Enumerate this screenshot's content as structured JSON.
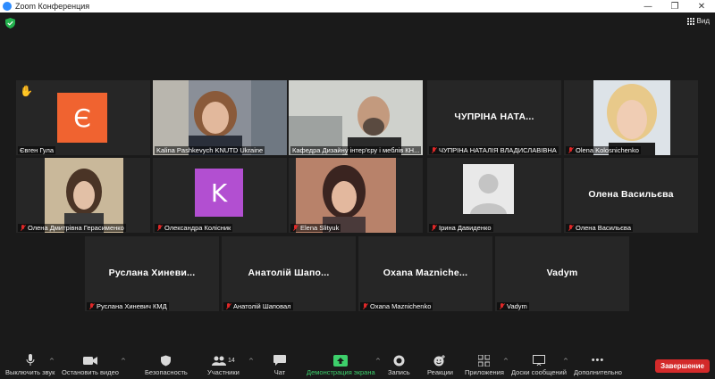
{
  "window": {
    "title": "Zoom Конференция",
    "minimize": "—",
    "maximize": "❐",
    "close": "✕"
  },
  "topbar": {
    "view_label": "Вид"
  },
  "participants": [
    {
      "id": "t1",
      "name": "Євген Гула",
      "avatar_letter": "Є",
      "avatar_color": "#f06330",
      "hand_raised": true,
      "muted": false
    },
    {
      "id": "t2",
      "name": "Kalina Pashkevych KNUTD Ukraine",
      "video": true,
      "muted": false
    },
    {
      "id": "t3",
      "name": "Кафедра Дизайну інтер'єру і меблів КН...",
      "video": true,
      "active_speaker": true,
      "muted": false
    },
    {
      "id": "t4",
      "name": "ЧУПРІНА НАТАЛІЯ ВЛАДИСЛАВІВНА",
      "display_name": "ЧУПРІНА НАТА...",
      "muted": true
    },
    {
      "id": "t5",
      "name": "Olena Kolosnichenko",
      "video": true,
      "muted": true
    },
    {
      "id": "t6",
      "name": "Олена Дмитрівна Герасименко",
      "video": true,
      "muted": true
    },
    {
      "id": "t7",
      "name": "Олександра Колісник",
      "avatar_letter": "K",
      "avatar_color": "#b24fd1",
      "muted": true
    },
    {
      "id": "t8",
      "name": "Elena Slityuk",
      "video": true,
      "muted": true
    },
    {
      "id": "t9",
      "name": "Ірина Давиденко",
      "placeholder_avatar": true,
      "muted": true
    },
    {
      "id": "t10",
      "name": "Олена Васильєва",
      "display_name": "Олена Васильєва",
      "muted": true
    },
    {
      "id": "t11",
      "name": "Руслана Хиневич КМД",
      "display_name": "Руслана Хиневи...",
      "muted": true
    },
    {
      "id": "t12",
      "name": "Анатолій Шаповал",
      "display_name": "Анатолій Шапо...",
      "muted": true
    },
    {
      "id": "t13",
      "name": "Oxana Maznichenko",
      "display_name": "Oxana Mazniche...",
      "muted": true
    },
    {
      "id": "t14",
      "name": "Vadym",
      "display_name": "Vadym",
      "muted": true
    }
  ],
  "toolbar": {
    "mute": "Выключить звук",
    "video": "Остановить видео",
    "security": "Безопасность",
    "participants": "Участники",
    "participants_count": "14",
    "chat": "Чат",
    "share": "Демонстрация экрана",
    "record": "Запись",
    "reactions": "Реакции",
    "apps": "Приложения",
    "whiteboards": "Доски сообщений",
    "more": "Дополнительно",
    "end": "Завершение"
  },
  "colors": {
    "active_speaker_border": "#95c93d",
    "share_green": "#3dcf6b",
    "end_red": "#d32a2a"
  }
}
